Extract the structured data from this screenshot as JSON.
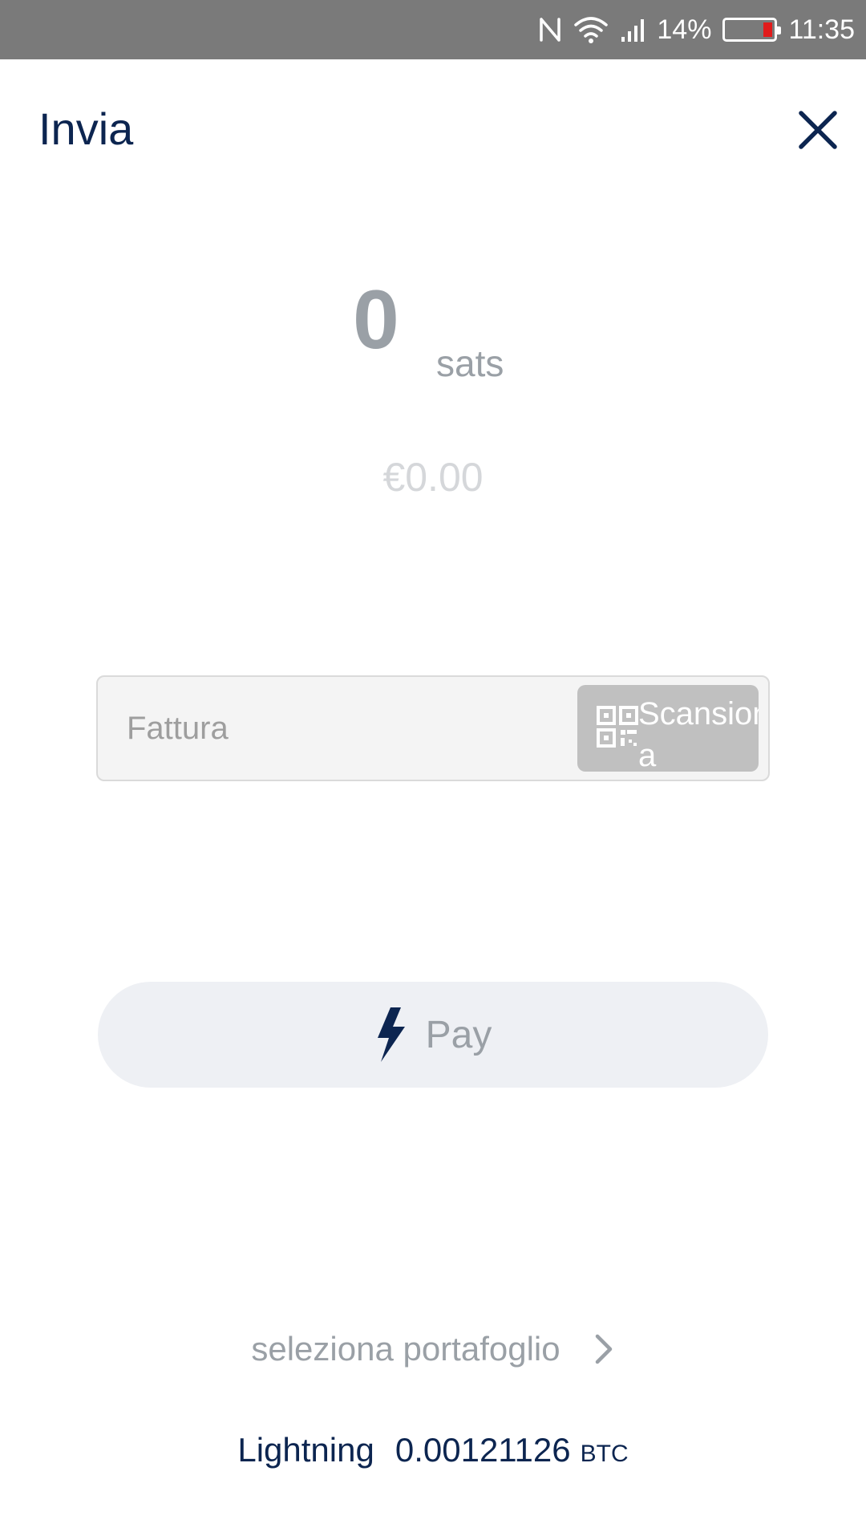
{
  "status_bar": {
    "battery_percent": "14%",
    "time": "11:35",
    "icons": [
      "nfc-icon",
      "wifi-icon",
      "signal-icon",
      "battery-icon"
    ]
  },
  "header": {
    "title": "Invia",
    "close_icon": "close-icon"
  },
  "amount": {
    "value": "0",
    "unit": "sats",
    "fiat": "€0.00"
  },
  "invoice": {
    "placeholder": "Fattura",
    "value": "",
    "scan_label": "Scansiona",
    "scan_icon": "qr-code-icon"
  },
  "pay_button": {
    "label": "Pay",
    "icon": "lightning-icon"
  },
  "wallet": {
    "select_label": "seleziona portafoglio",
    "name": "Lightning",
    "balance": "0.00121126",
    "unit": "BTC"
  },
  "colors": {
    "navy": "#0c2550",
    "muted": "#9aa0a6",
    "battery_low": "#e11b1b",
    "statusbar": "#7a7a7a"
  }
}
